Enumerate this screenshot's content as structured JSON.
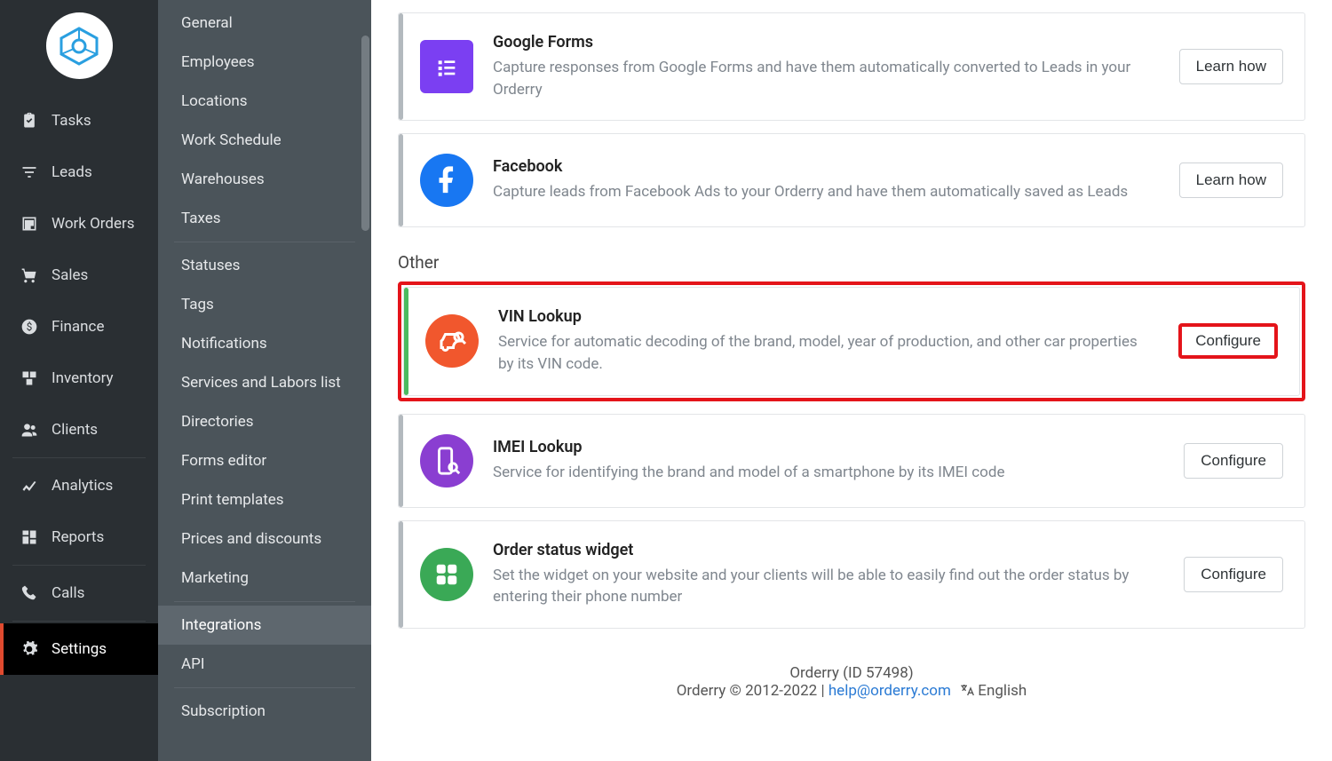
{
  "primary_nav": {
    "items": [
      {
        "label": "Tasks",
        "icon": "clipboard"
      },
      {
        "label": "Leads",
        "icon": "filter"
      },
      {
        "label": "Work Orders",
        "icon": "document"
      },
      {
        "label": "Sales",
        "icon": "cart"
      },
      {
        "label": "Finance",
        "icon": "dollar"
      },
      {
        "label": "Inventory",
        "icon": "boxes"
      },
      {
        "label": "Clients",
        "icon": "people"
      }
    ],
    "items2": [
      {
        "label": "Analytics",
        "icon": "chart"
      },
      {
        "label": "Reports",
        "icon": "grid"
      }
    ],
    "items3": [
      {
        "label": "Calls",
        "icon": "phone"
      }
    ],
    "items4": [
      {
        "label": "Settings",
        "icon": "gear",
        "active": true
      }
    ]
  },
  "secondary_nav": {
    "group1": [
      "General",
      "Employees",
      "Locations",
      "Work Schedule",
      "Warehouses",
      "Taxes"
    ],
    "group2": [
      "Statuses",
      "Tags",
      "Notifications",
      "Services and Labors list",
      "Directories",
      "Forms editor",
      "Print templates",
      "Prices and discounts",
      "Marketing"
    ],
    "group3": [
      "Integrations",
      "API"
    ],
    "group4": [
      "Subscription"
    ],
    "active": "Integrations"
  },
  "integrations": {
    "cards_top": [
      {
        "title": "Google Forms",
        "desc": "Capture responses from Google Forms and have them automatically converted to Leads in your Orderry",
        "button": "Learn how",
        "icon_bg": "#7b3ff2",
        "icon_shape": "square"
      },
      {
        "title": "Facebook",
        "desc": "Capture leads from Facebook Ads to your Orderry and have them automatically saved as Leads",
        "button": "Learn how",
        "icon_bg": "#1877f2",
        "icon_shape": "circle"
      }
    ],
    "section_other": "Other",
    "cards_other": [
      {
        "title": "VIN Lookup",
        "desc": "Service for automatic decoding of the brand, model, year of production, and other car properties by its VIN code.",
        "button": "Configure",
        "icon_bg": "#f1572d",
        "accent": "green",
        "highlighted": true
      },
      {
        "title": "IMEI Lookup",
        "desc": "Service for identifying the brand and model of a smartphone by its IMEI code",
        "button": "Configure",
        "icon_bg": "#8a3ed1",
        "accent": "gray"
      },
      {
        "title": "Order status widget",
        "desc": "Set the widget on your website and your clients will be able to easily find out the order status by entering their phone number",
        "button": "Configure",
        "icon_bg": "#3aa956",
        "accent": "gray"
      }
    ]
  },
  "footer": {
    "line1": "Orderry (ID 57498)",
    "copyright": "Orderry © 2012-2022 | ",
    "email": "help@orderry.com",
    "lang": "English"
  }
}
